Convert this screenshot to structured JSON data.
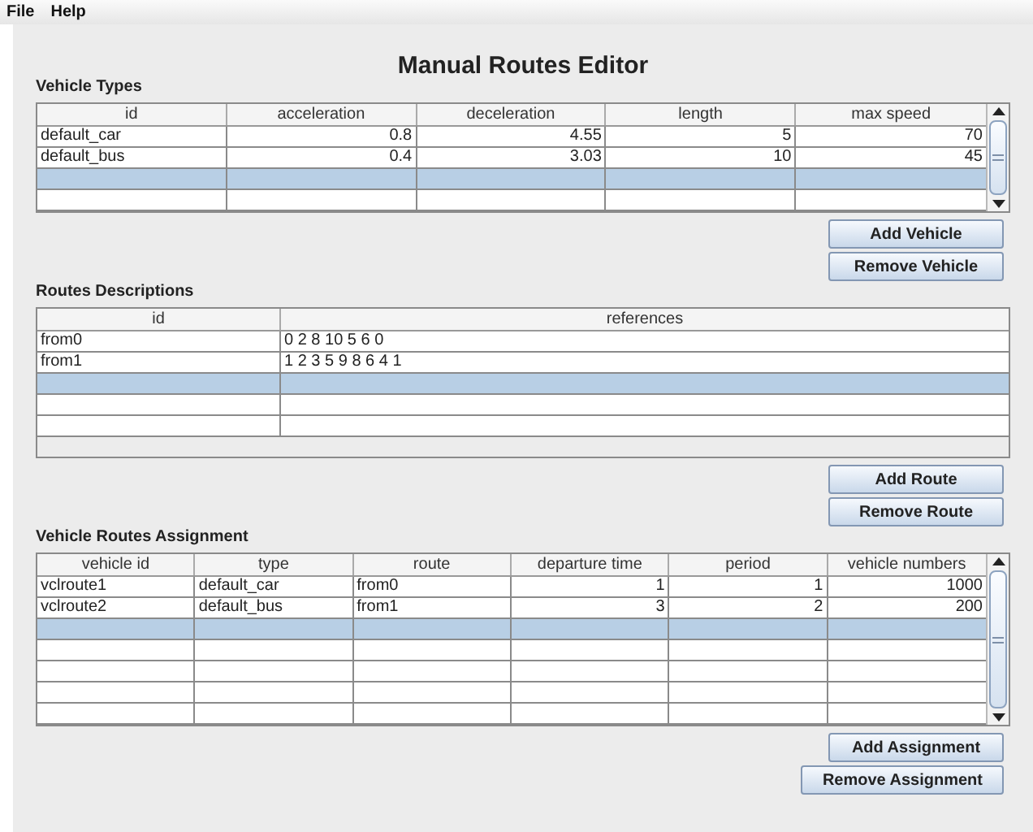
{
  "menu": [
    "File",
    "Help"
  ],
  "title": "Manual Routes Editor",
  "sections": [
    {
      "heading": "Vehicle Types",
      "scrollable": true,
      "filler": false,
      "columns": [
        {
          "label": "id",
          "kind": "text"
        },
        {
          "label": "acceleration",
          "kind": "number"
        },
        {
          "label": "deceleration",
          "kind": "number"
        },
        {
          "label": "length",
          "kind": "number"
        },
        {
          "label": "max speed",
          "kind": "number"
        }
      ],
      "rows": [
        {
          "selected": false,
          "cells": [
            "default_car",
            "0.8",
            "4.55",
            "5",
            "70"
          ]
        },
        {
          "selected": false,
          "cells": [
            "default_bus",
            "0.4",
            "3.03",
            "10",
            "45"
          ]
        },
        {
          "selected": true
        },
        {
          "selected": false
        }
      ],
      "buttons": [
        "Add Vehicle",
        "Remove Vehicle"
      ]
    },
    {
      "heading": "Routes Descriptions",
      "scrollable": false,
      "filler": true,
      "columns": [
        {
          "label": "id",
          "kind": "text"
        },
        {
          "label": "references",
          "kind": "text"
        }
      ],
      "rows": [
        {
          "selected": false,
          "cells": [
            "from0",
            "0 2 8 10 5 6 0"
          ]
        },
        {
          "selected": false,
          "cells": [
            "from1",
            "1 2 3 5 9 8 6 4 1"
          ]
        },
        {
          "selected": true
        },
        {
          "selected": false
        },
        {
          "selected": false
        }
      ],
      "buttons": [
        "Add Route",
        "Remove Route"
      ]
    },
    {
      "heading": "Vehicle Routes Assignment",
      "scrollable": true,
      "filler": false,
      "columns": [
        {
          "label": "vehicle id",
          "kind": "text"
        },
        {
          "label": "type",
          "kind": "text"
        },
        {
          "label": "route",
          "kind": "text"
        },
        {
          "label": "departure time",
          "kind": "number"
        },
        {
          "label": "period",
          "kind": "number"
        },
        {
          "label": "vehicle numbers",
          "kind": "number"
        }
      ],
      "rows": [
        {
          "selected": false,
          "cells": [
            "vclroute1",
            "default_car",
            "from0",
            "1",
            "1",
            "1000"
          ]
        },
        {
          "selected": false,
          "cells": [
            "vclroute2",
            "default_bus",
            "from1",
            "3",
            "2",
            "200"
          ]
        },
        {
          "selected": true
        },
        {
          "selected": false
        },
        {
          "selected": false
        },
        {
          "selected": false
        },
        {
          "selected": false
        }
      ],
      "buttons": [
        "Add Assignment",
        "Remove Assignment"
      ]
    }
  ]
}
